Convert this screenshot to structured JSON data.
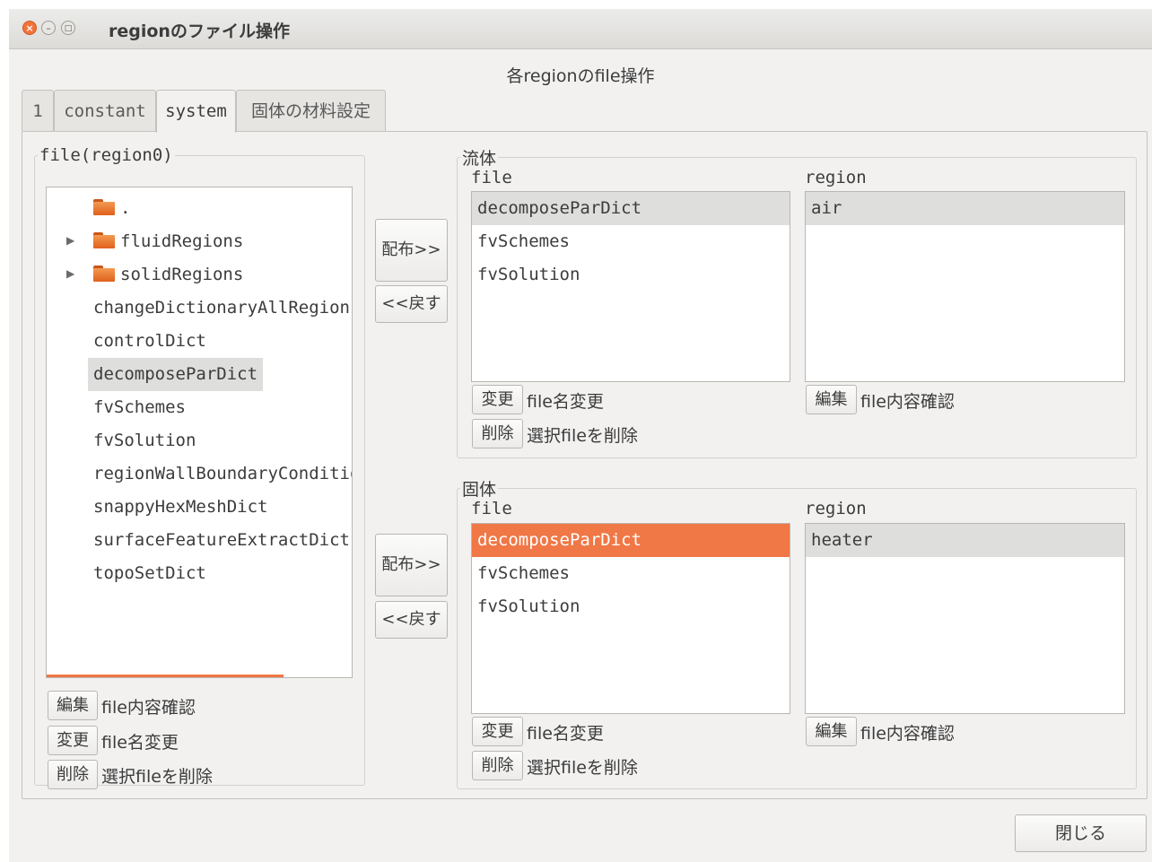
{
  "window": {
    "title": "regionのファイル操作"
  },
  "dialog": {
    "heading": "各regionのfile操作"
  },
  "tabs": [
    {
      "label": "1"
    },
    {
      "label": "constant"
    },
    {
      "label": "system"
    },
    {
      "label": "固体の材料設定"
    }
  ],
  "left_panel": {
    "title": "file(region0)",
    "tree": [
      {
        "label": ".",
        "type": "folder"
      },
      {
        "label": "fluidRegions",
        "type": "folder"
      },
      {
        "label": "solidRegions",
        "type": "folder"
      },
      {
        "label": "changeDictionaryAllRegionsDict",
        "type": "file"
      },
      {
        "label": "controlDict",
        "type": "file"
      },
      {
        "label": "decomposeParDict",
        "type": "file"
      },
      {
        "label": "fvSchemes",
        "type": "file"
      },
      {
        "label": "fvSolution",
        "type": "file"
      },
      {
        "label": "regionWallBoundaryConditionsDict",
        "type": "file"
      },
      {
        "label": "snappyHexMeshDict",
        "type": "file"
      },
      {
        "label": "surfaceFeatureExtractDict",
        "type": "file"
      },
      {
        "label": "topoSetDict",
        "type": "file"
      }
    ],
    "selected": "decomposeParDict",
    "buttons": [
      {
        "label": "編集",
        "desc": "file内容確認"
      },
      {
        "label": "変更",
        "desc": "file名変更"
      },
      {
        "label": "削除",
        "desc": "選択fileを削除"
      }
    ]
  },
  "transfer": {
    "distribute_label": "配布>>",
    "back_label": "<<戻す"
  },
  "fluid": {
    "title": "流体",
    "file_header": "file",
    "region_header": "region",
    "files": [
      "decomposeParDict",
      "fvSchemes",
      "fvSolution"
    ],
    "regions": [
      "air"
    ],
    "selected_file": "decomposeParDict",
    "selected_region": "air",
    "rename_button": "変更",
    "rename_desc": "file名変更",
    "delete_button": "削除",
    "delete_desc": "選択fileを削除",
    "edit_button": "編集",
    "edit_desc": "file内容確認"
  },
  "solid": {
    "title": "固体",
    "file_header": "file",
    "region_header": "region",
    "files": [
      "decomposeParDict",
      "fvSchemes",
      "fvSolution"
    ],
    "regions": [
      "heater"
    ],
    "selected_file": "decomposeParDict",
    "selected_region": "heater",
    "rename_button": "変更",
    "rename_desc": "file名変更",
    "delete_button": "削除",
    "delete_desc": "選択fileを削除",
    "edit_button": "編集",
    "edit_desc": "file内容確認"
  },
  "footer": {
    "close_label": "閉じる"
  },
  "colors": {
    "accent": "#f07746",
    "selection_gray": "#dededc"
  }
}
